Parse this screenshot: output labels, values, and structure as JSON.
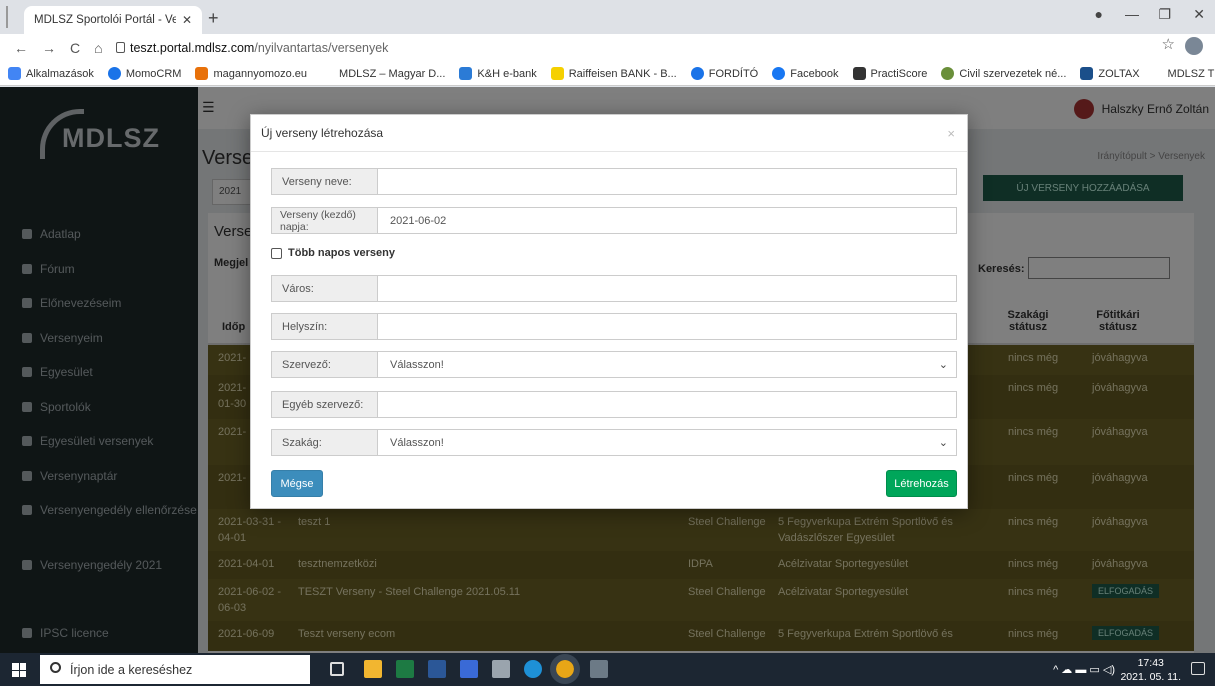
{
  "browser": {
    "tab_title": "MDLSZ Sportolói Portál - Versen",
    "url_host": "teszt.portal.mdlsz.com",
    "url_path": "/nyilvantartas/versenyek",
    "bookmarks": [
      "Alkalmazások",
      "MomoCRM",
      "magannyomozo.eu",
      "MDLSZ – Magyar D...",
      "K&H e-bank",
      "Raiffeisen BANK - B...",
      "FORDÍTÓ",
      "Facebook",
      "PractiScore",
      "Civil szervezetek né...",
      "ZOLTAX",
      "MDLSZ TESZT Spor..."
    ]
  },
  "app": {
    "logo": "MDLSZ",
    "user_name": "Halszky Ernő Zoltán",
    "sidebar": [
      "Adatlap",
      "Fórum",
      "Előnevezéseim",
      "Versenyeim",
      "Egyesület",
      "Sportolók",
      "Egyesületi versenyek",
      "Versenynaptár",
      "Versenyengedély ellenőrzése",
      "Versenyengedély 2021",
      "IPSC licence"
    ],
    "page_title": "Verseny",
    "breadcrumb": "Irányítópult > Versenyek",
    "year": "2021",
    "add_button": "ÚJ VERSENY HOZZÁADÁSA",
    "panel_title": "Verser",
    "show_label": "Megjel",
    "search_label": "Keresés:",
    "headers": {
      "date": "Időp",
      "szakagi": "Szakági státusz",
      "fotitkari": "Főtitkári státusz"
    },
    "rows": [
      {
        "date": "2021-",
        "name": "",
        "branch": "",
        "org": "",
        "szakagi": "nincs még",
        "fotitkari": "jóváhagyva"
      },
      {
        "date": "2021-\n01-30",
        "name": "",
        "branch": "",
        "org": "",
        "szakagi": "nincs még",
        "fotitkari": "jóváhagyva"
      },
      {
        "date": "2021-",
        "name": "",
        "branch": "",
        "org": "",
        "szakagi": "nincs még",
        "fotitkari": "jóváhagyva"
      },
      {
        "date": "2021-",
        "name": "",
        "branch": "",
        "org": "",
        "szakagi": "nincs még",
        "fotitkari": "jóváhagyva"
      },
      {
        "date": "2021-03-31 -\n04-01",
        "name": "teszt 1",
        "branch": "Steel Challenge",
        "org": "5 Fegyverkupa Extrém Sportlövő és\nVadászlőszer Egyesület",
        "szakagi": "nincs még",
        "fotitkari": "jóváhagyva"
      },
      {
        "date": "2021-04-01",
        "name": "tesztnemzetközi",
        "branch": "IDPA",
        "org": "Acélzivatar Sportegyesület",
        "szakagi": "nincs még",
        "fotitkari": "jóváhagyva"
      },
      {
        "date": "2021-06-02 -\n06-03",
        "name": "TESZT Verseny - Steel Challenge 2021.05.11",
        "branch": "Steel Challenge",
        "org": "Acélzivatar Sportegyesület",
        "szakagi": "nincs még",
        "fotitkari": "ELFOGADÁS"
      },
      {
        "date": "2021-06-09",
        "name": "Teszt verseny ecom",
        "branch": "Steel Challenge",
        "org": "5 Fegyverkupa Extrém Sportlövő és",
        "szakagi": "nincs még",
        "fotitkari": "ELFOGADÁS"
      }
    ]
  },
  "modal": {
    "title": "Új verseny létrehozása",
    "fields": [
      {
        "label": "Verseny neve:",
        "value": ""
      },
      {
        "label": "Verseny (kezdő) napja:",
        "value": "2021-06-02"
      },
      {
        "label": "Város:",
        "value": ""
      },
      {
        "label": "Helyszín:",
        "value": ""
      },
      {
        "label": "Szervező:",
        "value": "Válasszon!"
      },
      {
        "label": "Egyéb szervező:",
        "value": ""
      },
      {
        "label": "Szakág:",
        "value": "Válasszon!"
      }
    ],
    "multi_day_label": "Több napos verseny",
    "cancel_label": "Mégse",
    "create_label": "Létrehozás"
  },
  "taskbar": {
    "search_placeholder": "Írjon ide a kereséshez",
    "time": "17:43",
    "date": "2021. 05. 11."
  }
}
